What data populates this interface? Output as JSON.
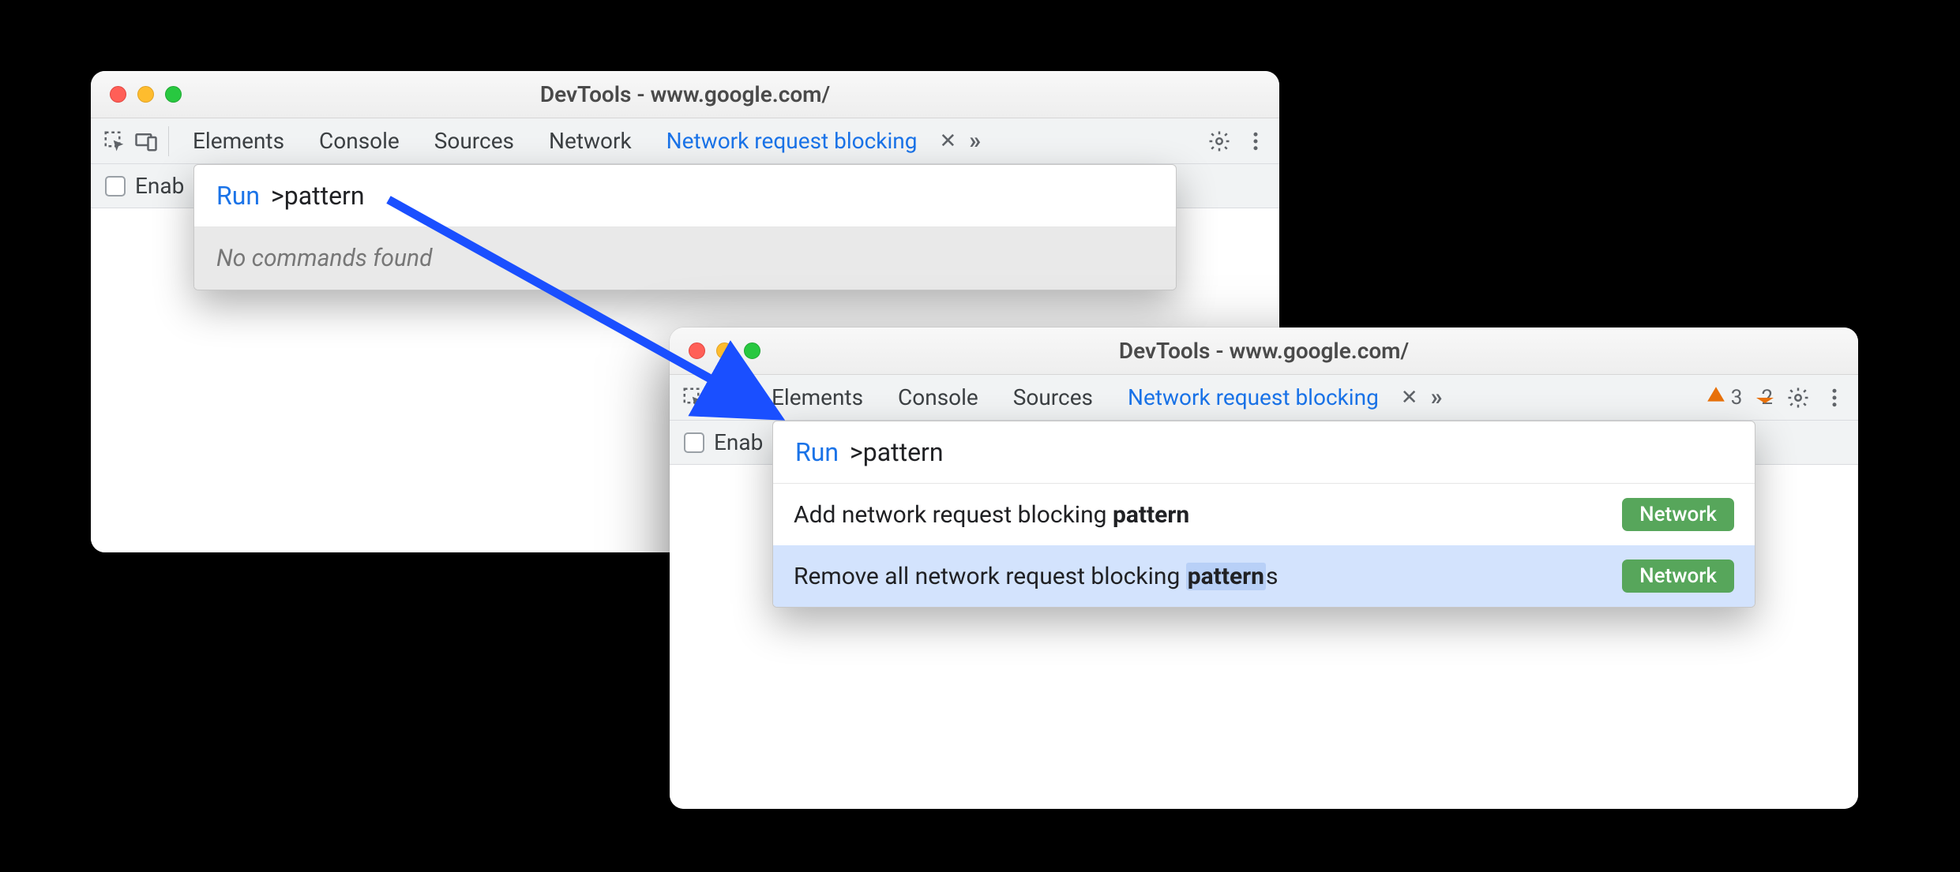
{
  "window_a": {
    "title": "DevTools - www.google.com/",
    "tabs": {
      "elements": "Elements",
      "console": "Console",
      "sources": "Sources",
      "network": "Network",
      "nrb": "Network request blocking"
    },
    "enable_label": "Enab",
    "palette": {
      "run": "Run",
      "query": ">pattern",
      "empty": "No commands found"
    }
  },
  "window_b": {
    "title": "DevTools - www.google.com/",
    "tabs": {
      "elements": "Elements",
      "console": "Console",
      "sources": "Sources",
      "nrb": "Network request blocking"
    },
    "badges": {
      "warnings": "3",
      "issues": "2"
    },
    "enable_label": "Enab",
    "palette": {
      "run": "Run",
      "query": ">pattern",
      "items": [
        {
          "pre": "Add network request blocking ",
          "match": "pattern",
          "post": "",
          "cat": "Network"
        },
        {
          "pre": "Remove all network request blocking ",
          "match": "pattern",
          "post": "s",
          "cat": "Network"
        }
      ]
    }
  }
}
